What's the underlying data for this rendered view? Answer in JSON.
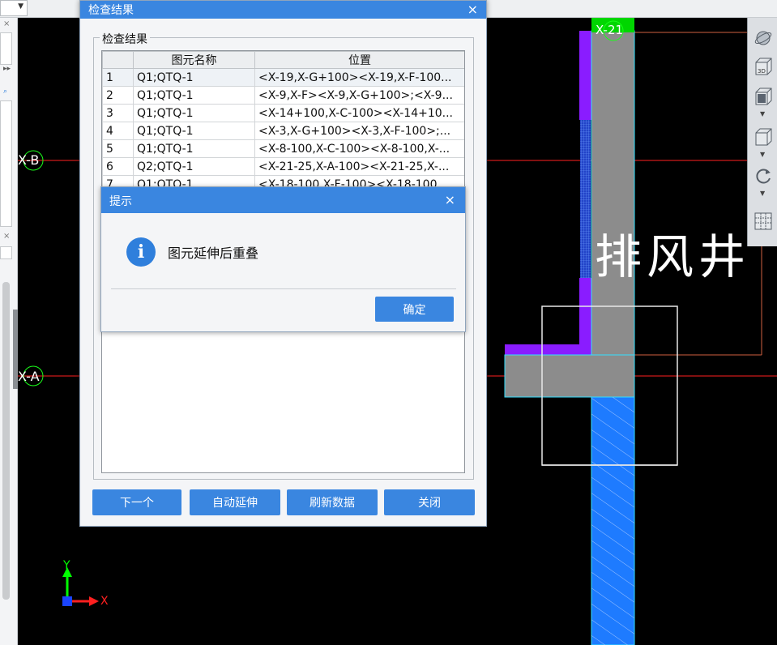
{
  "main_dialog": {
    "title": "检查结果",
    "close_glyph": "×",
    "group_label": "检查结果",
    "columns": [
      "",
      "图元名称",
      "位置"
    ],
    "rows": [
      {
        "index": "1",
        "name": "Q1;QTQ-1",
        "position": "<X-19,X-G+100><X-19,X-F-100..."
      },
      {
        "index": "2",
        "name": "Q1;QTQ-1",
        "position": "<X-9,X-F><X-9,X-G+100>;<X-9..."
      },
      {
        "index": "3",
        "name": "Q1;QTQ-1",
        "position": "<X-14+100,X-C-100><X-14+10..."
      },
      {
        "index": "4",
        "name": "Q1;QTQ-1",
        "position": "<X-3,X-G+100><X-3,X-F-100>;..."
      },
      {
        "index": "5",
        "name": "Q1;QTQ-1",
        "position": "<X-8-100,X-C-100><X-8-100,X-..."
      },
      {
        "index": "6",
        "name": "Q2;QTQ-1",
        "position": "<X-21-25,X-A-100><X-21-25,X-..."
      },
      {
        "index": "7",
        "name": "Q1;QTQ-1",
        "position": "<X-18-100,X-F-100><X-18-100..."
      }
    ],
    "buttons": {
      "next": "下一个",
      "auto_extend": "自动延伸",
      "refresh": "刷新数据",
      "close": "关闭"
    }
  },
  "tip_dialog": {
    "title": "提示",
    "close_glyph": "×",
    "icon_glyph": "i",
    "message": "图元延伸后重叠",
    "ok": "确定"
  },
  "canvas": {
    "grid_label_x21": "X-21",
    "grid_label_xb": "X-B",
    "grid_label_xa": "X-A",
    "room_label": "排风井",
    "axis_y": "Y",
    "axis_x": "X"
  },
  "colors": {
    "title_bar": "#3a86e0",
    "canvas_bg": "#000000",
    "grid_line": "#ff2020",
    "wall_purple": "#8a1cff",
    "wall_blue": "#1e7bff",
    "wall_gray": "#8c8c8c",
    "axis_green": "#00ff00"
  },
  "icons": {
    "toolbar": [
      "orbit-icon",
      "view-3d-icon",
      "box-view-icon",
      "box-outline-icon",
      "rotate-icon",
      "grid-panel-icon"
    ],
    "left_panel": [
      "close-icon",
      "expand-icon",
      "search-icon"
    ]
  }
}
